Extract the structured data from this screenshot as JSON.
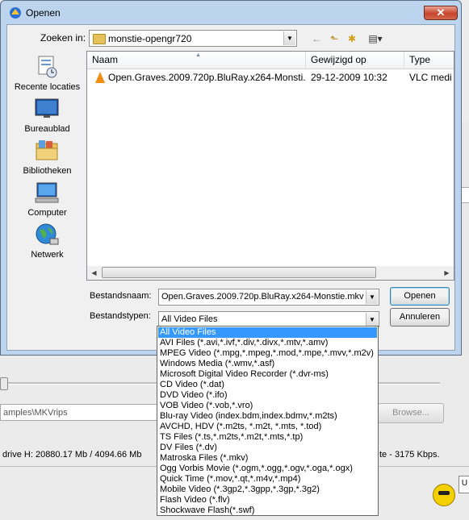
{
  "dialog": {
    "title": "Openen",
    "close_label": "✕",
    "look_in_label": "Zoeken in:",
    "look_in_value": "monstie-opengr720",
    "toolbar": {
      "back": "←",
      "up": "⬑",
      "new_folder": "✱",
      "view": "▤▾"
    }
  },
  "places": [
    {
      "label": "Recente locaties",
      "icon": "recent-locations-icon"
    },
    {
      "label": "Bureaublad",
      "icon": "desktop-icon"
    },
    {
      "label": "Bibliotheken",
      "icon": "libraries-icon"
    },
    {
      "label": "Computer",
      "icon": "computer-icon"
    },
    {
      "label": "Netwerk",
      "icon": "network-icon"
    }
  ],
  "file_list": {
    "columns": [
      "Naam",
      "Gewijzigd op",
      "Type"
    ],
    "rows": [
      {
        "name": "Open.Graves.2009.720p.BluRay.x264-Monsti...",
        "modified": "29-12-2009 10:32",
        "type": "VLC medi"
      }
    ]
  },
  "filename": {
    "label": "Bestandsnaam:",
    "value": "Open.Graves.2009.720p.BluRay.x264-Monstie.mkv"
  },
  "filetype": {
    "label": "Bestandstypen:",
    "value": "All Video Files"
  },
  "buttons": {
    "open": "Openen",
    "cancel": "Annuleren"
  },
  "filetype_options": [
    "All Video Files",
    "AVI Files (*.avi,*.ivf,*.div,*.divx,*.mtv,*.amv)",
    "MPEG Video (*.mpg,*.mpeg,*.mod,*.mpe,*.mvv,*.m2v)",
    "Windows Media (*.wmv,*.asf)",
    "Microsoft Digital Video Recorder (*.dvr-ms)",
    "CD Video (*.dat)",
    "DVD Video (*.ifo)",
    "VOB Video (*.vob,*.vro)",
    "Blu-ray Video (index.bdm,index.bdmv,*.m2ts)",
    "AVCHD, HDV (*.m2ts, *.m2t, *.mts, *.tod)",
    "TS Files (*.ts,*.m2ts,*.m2t,*.mts,*.tp)",
    "DV Files (*.dv)",
    "Matroska Files (*.mkv)",
    "Ogg Vorbis Movie (*.ogm,*.ogg,*.ogv,*.oga,*.ogx)",
    "Quick Time (*.mov,*.qt,*.m4v,*.mp4)",
    "Mobile Video (*.3gp2,*.3gpp,*.3gp,*.3g2)",
    "Flash Video (*.flv)",
    "Shockwave Flash(*.swf)"
  ],
  "background_app": {
    "path_text": "amples\\MKVrips",
    "browse_label": "Browse...",
    "status_left": "drive  H: 20880.17 Mb / 4094.66 Mb",
    "status_right": "te - 3175 Kbps.",
    "corner_text": "U"
  }
}
